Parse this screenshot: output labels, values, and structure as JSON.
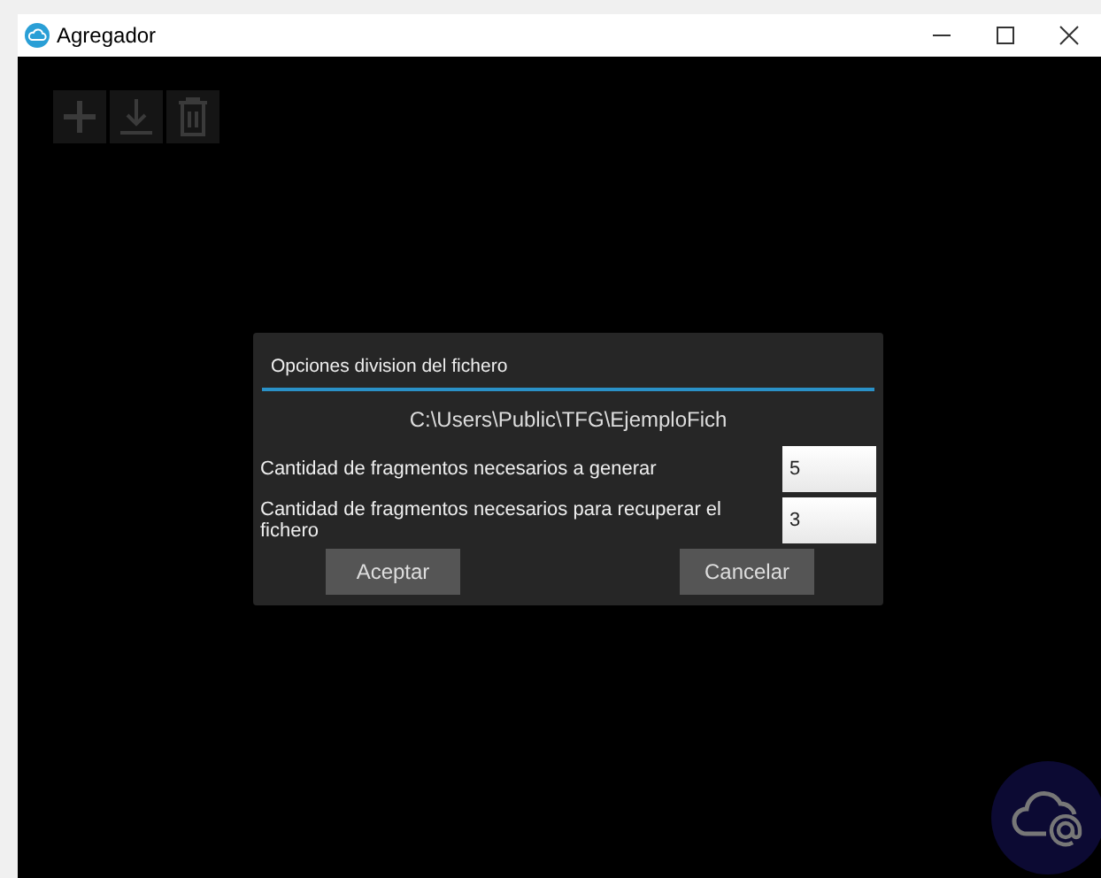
{
  "window": {
    "title": "Agregador"
  },
  "toolbar": {
    "buttons": [
      {
        "kind": "add",
        "disabled": true
      },
      {
        "kind": "download",
        "disabled": true
      },
      {
        "kind": "delete",
        "disabled": true
      }
    ]
  },
  "dialog": {
    "title": "Opciones division del fichero",
    "path": "C:\\Users\\Public\\TFG\\EjemploFich",
    "fields": [
      {
        "label": "Cantidad de fragmentos necesarios a generar",
        "value": "5"
      },
      {
        "label": "Cantidad de fragmentos necesarios para recuperar el fichero",
        "value": "3"
      }
    ],
    "buttons": [
      {
        "label": "Aceptar"
      },
      {
        "label": "Cancelar"
      }
    ]
  }
}
